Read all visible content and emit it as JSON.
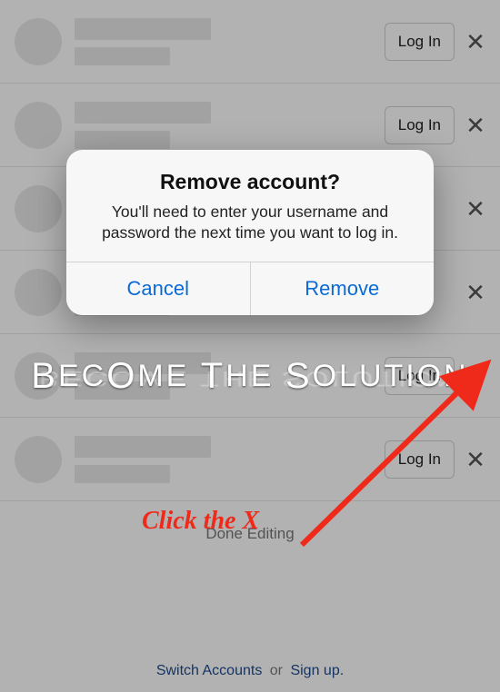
{
  "accounts": [
    {
      "login_label": "Log In"
    },
    {
      "login_label": "Log In"
    },
    {
      "login_label": ""
    },
    {
      "login_label": ""
    },
    {
      "login_label": "Log In"
    },
    {
      "login_label": "Log In"
    }
  ],
  "remove_glyph": "✕",
  "done_editing": "Done Editing",
  "footer": {
    "switch": "Switch Accounts",
    "or": "or",
    "signup": "Sign up."
  },
  "alert": {
    "title": "Remove account?",
    "message": "You'll need to enter your username and password the next time you want to log in.",
    "cancel": "Cancel",
    "confirm": "Remove"
  },
  "watermark": "BECOME THE SOLUTION",
  "annotation": "Click the X"
}
